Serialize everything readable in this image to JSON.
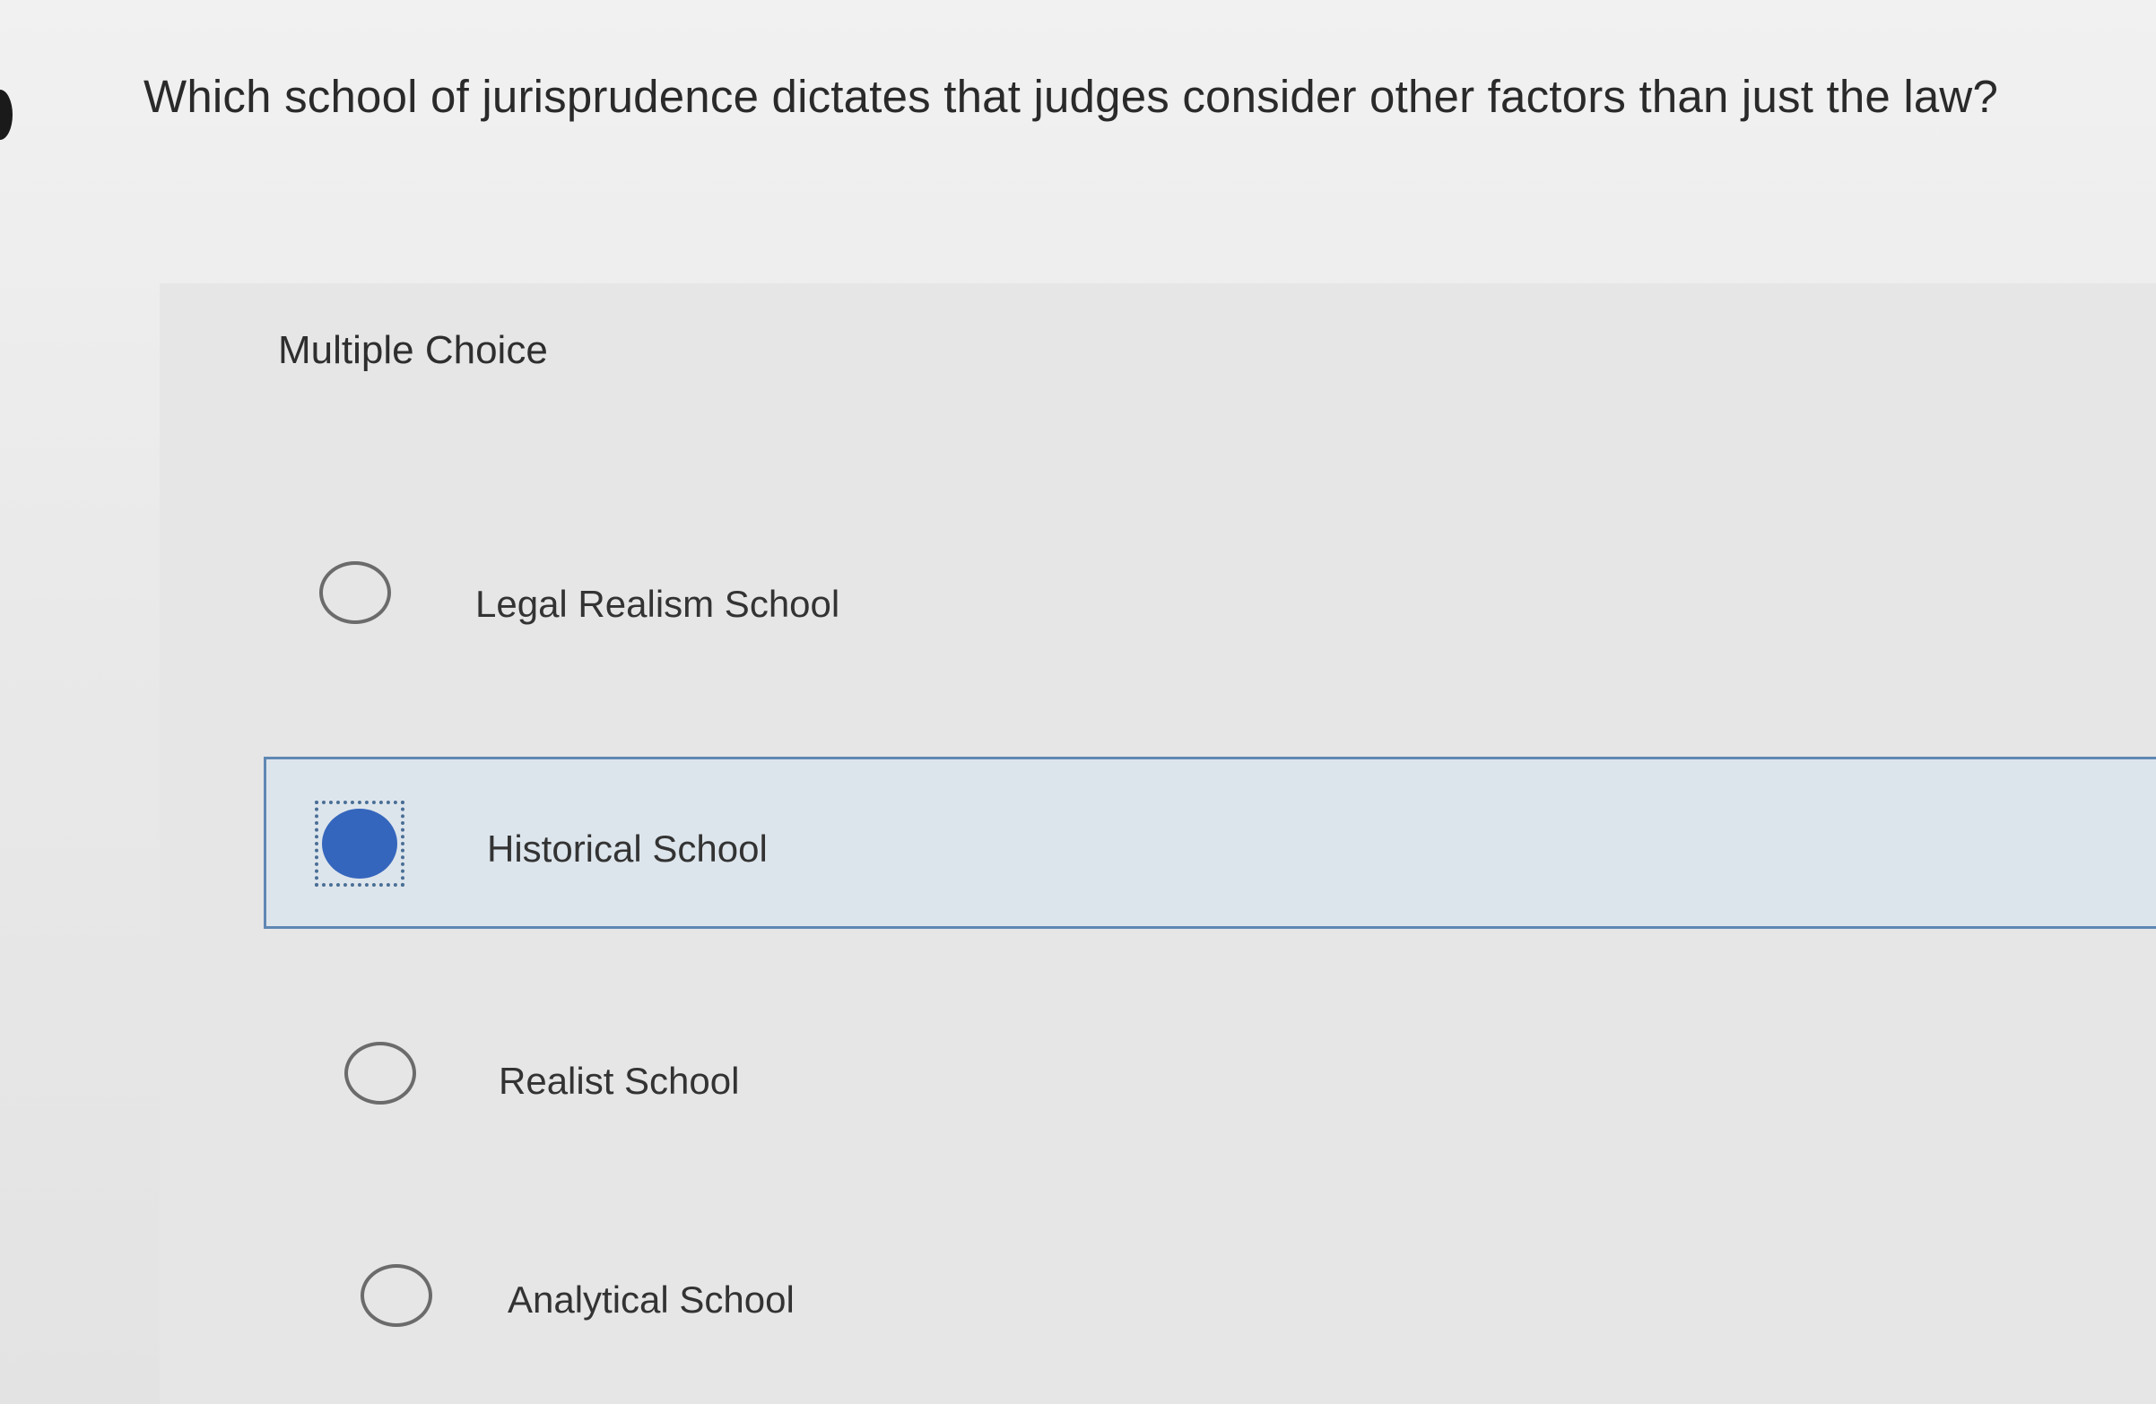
{
  "question": {
    "text": "Which school of jurisprudence dictates that judges consider other factors than just the law?"
  },
  "question_type": "Multiple Choice",
  "options": [
    {
      "label": "Legal Realism School",
      "selected": false
    },
    {
      "label": "Historical School",
      "selected": true
    },
    {
      "label": "Realist School",
      "selected": false
    },
    {
      "label": "Analytical School",
      "selected": false
    }
  ],
  "colors": {
    "selected_fill": "#3566bd",
    "selected_border": "#5f87b3",
    "selected_background": "#dde5ec"
  }
}
